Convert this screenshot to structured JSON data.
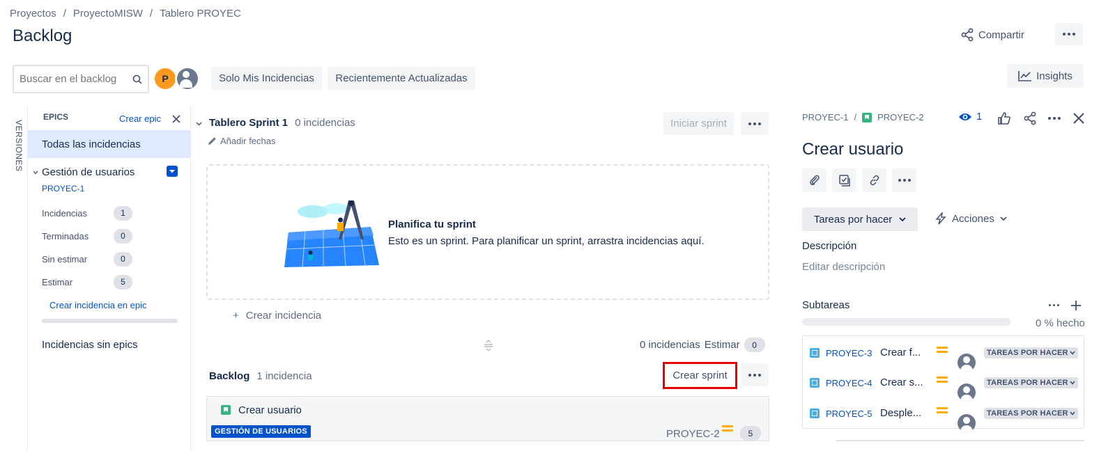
{
  "breadcrumb": [
    "Proyectos",
    "ProyectoMISW",
    "Tablero PROYEC"
  ],
  "breadcrumb_sep": "/",
  "page_title": "Backlog",
  "header": {
    "share_label": "Compartir",
    "insights_label": "Insights"
  },
  "search": {
    "placeholder": "Buscar en el backlog"
  },
  "avatar_initial": "P",
  "filters": [
    "Solo Mis Incidencias",
    "Recientemente Actualizadas"
  ],
  "versions_tab": "VERSIONES",
  "epics_panel": {
    "title": "EPICS",
    "create_label": "Crear epic",
    "all_issues": "Todas las incidencias",
    "epic": {
      "name": "Gestión de usuarios",
      "key": "PROYEC-1",
      "stats": [
        {
          "label": "Incidencias",
          "value": "1"
        },
        {
          "label": "Terminadas",
          "value": "0"
        },
        {
          "label": "Sin estimar",
          "value": "0"
        },
        {
          "label": "Estimar",
          "value": "5"
        }
      ],
      "create_issue": "Crear incidencia en epic"
    },
    "no_epic": "Incidencias sin epics"
  },
  "sprint": {
    "name": "Tablero Sprint 1",
    "count": "0 incidencias",
    "add_dates": "Añadir fechas",
    "start_label": "Iniciar sprint",
    "empty_title": "Planifica tu sprint",
    "empty_text": "Esto es un sprint. Para planificar un sprint, arrastra incidencias aquí.",
    "create_issue": "Crear incidencia",
    "footer_count": "0 incidencias",
    "estimate_label": "Estimar",
    "estimate_value": "0"
  },
  "backlog": {
    "title": "Backlog",
    "count": "1 incidencia",
    "create_sprint": "Crear sprint",
    "issue": {
      "summary": "Crear usuario",
      "epic_label": "GESTIÓN DE USUARIOS",
      "key": "PROYEC-2",
      "points": "5"
    }
  },
  "detail": {
    "parent_key": "PROYEC-1",
    "key": "PROYEC-2",
    "watchers": "1",
    "title": "Crear usuario",
    "status_label": "Tareas por hacer",
    "actions_label": "Acciones",
    "description_label": "Descripción",
    "description_placeholder": "Editar descripción",
    "subtasks_label": "Subtareas",
    "progress_label": "0 % hecho",
    "progress": 0,
    "subtasks": [
      {
        "key": "PROYEC-3",
        "summary": "Crear f...",
        "status": "TAREAS POR HACER"
      },
      {
        "key": "PROYEC-4",
        "summary": "Crear s...",
        "status": "TAREAS POR HACER"
      },
      {
        "key": "PROYEC-5",
        "summary": "Desple...",
        "status": "TAREAS POR HACER"
      }
    ]
  },
  "colors": {
    "accent": "#0052cc",
    "highlight": "#e60000",
    "epic": "#0052cc",
    "priority": "#ffab00",
    "avatar": "#ff991f"
  }
}
